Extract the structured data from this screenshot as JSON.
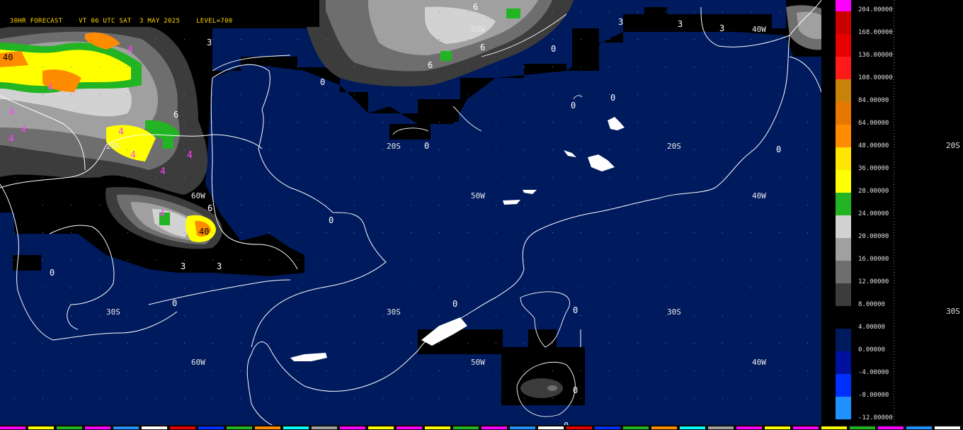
{
  "header": {
    "forecast": "30HR FORECAST",
    "valid_time": "VT 06 UTC SAT  3 MAY 2025",
    "level": "LEVEL=700"
  },
  "grid_labels": {
    "lon_60w": "60W",
    "lon_50w": "50W",
    "lon_40w": "40W",
    "lat_20s": "20S",
    "lat_30s": "30S"
  },
  "contour_values": [
    "0",
    "3",
    "4",
    "6",
    "40"
  ],
  "legend": {
    "colorbar": [
      {
        "label": "204.00000",
        "color": "#ff00ff"
      },
      {
        "label": "168.00000",
        "color": "#c80000"
      },
      {
        "label": "136.00000",
        "color": "#e60000"
      },
      {
        "label": "108.00000",
        "color": "#ff1a1a"
      },
      {
        "label": "84.00000",
        "color": "#c8820a"
      },
      {
        "label": "64.00000",
        "color": "#e67800"
      },
      {
        "label": "48.00000",
        "color": "#ff8c00"
      },
      {
        "label": "36.00000",
        "color": "#ffe600"
      },
      {
        "label": "28.00000",
        "color": "#ffff00"
      },
      {
        "label": "24.00000",
        "color": "#22b422"
      },
      {
        "label": "20.00000",
        "color": "#d2d2d2"
      },
      {
        "label": "16.00000",
        "color": "#a0a0a0"
      },
      {
        "label": "12.00000",
        "color": "#6e6e6e"
      },
      {
        "label": "8.00000",
        "color": "#3c3c3c"
      },
      {
        "label": "4.00000",
        "color": "#000000"
      },
      {
        "label": "0.00000",
        "color": "#001a5e"
      },
      {
        "label": "-4.00000",
        "color": "#0010a0"
      },
      {
        "label": "-8.00000",
        "color": "#0030ff"
      },
      {
        "label": "-12.00000",
        "color": "#2090ff"
      }
    ]
  },
  "right_edge_labels": {
    "lat_20s": "20S",
    "lat_30s": "30S"
  }
}
